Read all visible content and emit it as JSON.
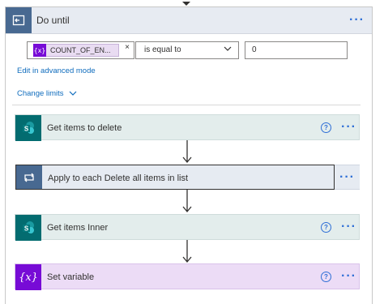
{
  "do_until": {
    "title": "Do until",
    "condition": {
      "token_icon": "{x}",
      "token_label": "COUNT_OF_EN...",
      "token_close": "×",
      "operator": "is equal to",
      "value": "0"
    },
    "edit_advanced_label": "Edit in advanced mode",
    "change_limits_label": "Change limits"
  },
  "actions": [
    {
      "title": "Get items to delete",
      "icon": "sharepoint-icon",
      "help": "?",
      "color": "#036c70"
    },
    {
      "title": "Apply to each Delete all items in list",
      "icon": "loop-icon",
      "color": "#486991"
    },
    {
      "title": "Get items Inner",
      "icon": "sharepoint-icon",
      "help": "?",
      "color": "#036c70"
    },
    {
      "title": "Set variable",
      "icon": "variable-icon",
      "icon_text": "{x}",
      "help": "?",
      "color": "#770bd6"
    }
  ],
  "ellipsis": "···",
  "colors": {
    "accent": "#2f6fd6",
    "link": "#0f6cbd"
  }
}
